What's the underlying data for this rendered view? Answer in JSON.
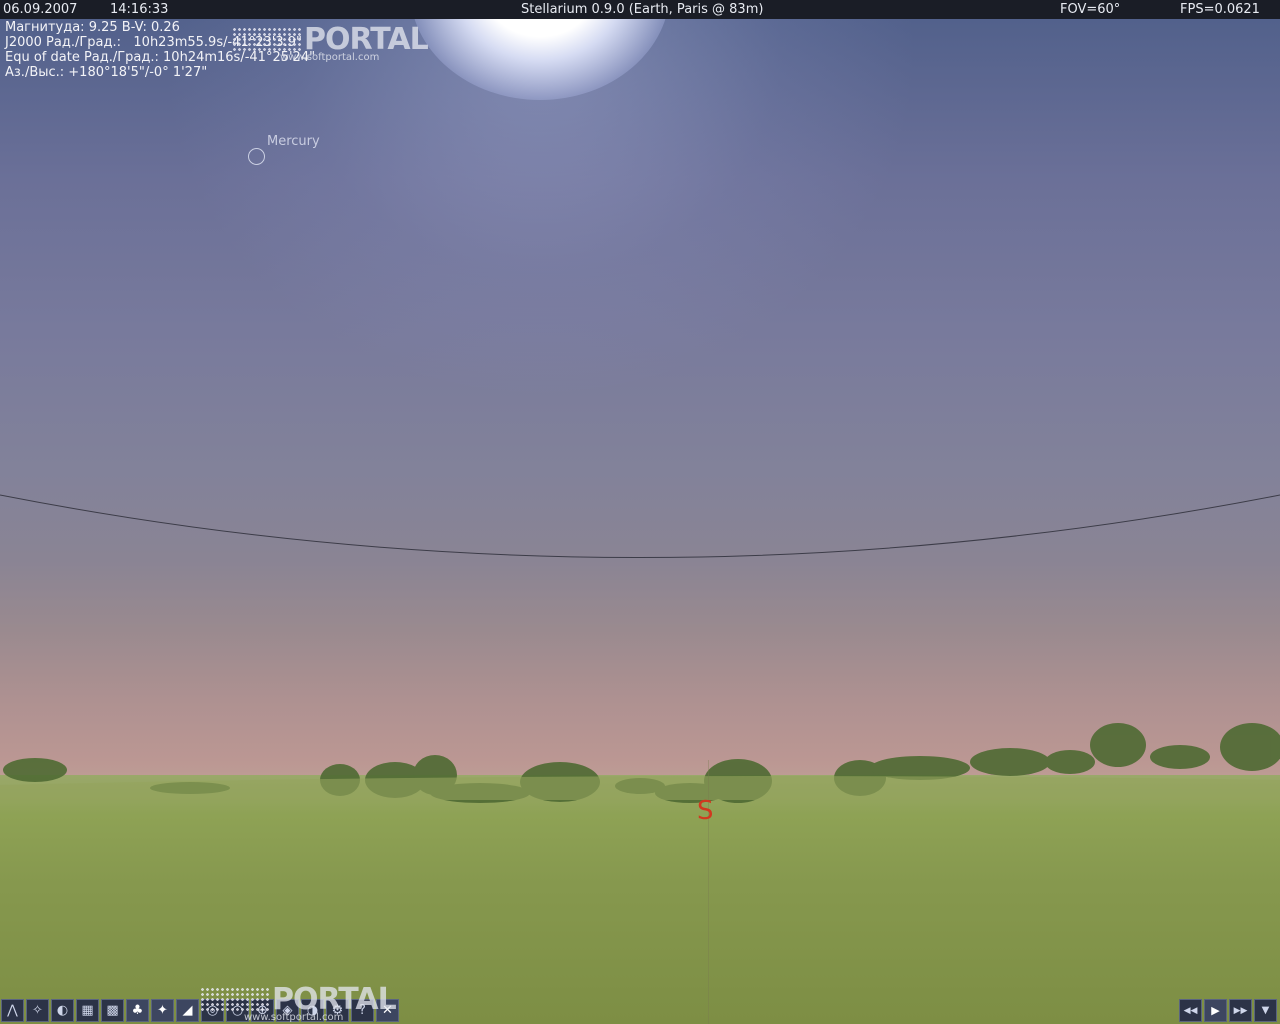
{
  "topbar": {
    "date": "06.09.2007",
    "time": "14:16:33",
    "title": "Stellarium 0.9.0 (Earth, Paris @ 83m)",
    "fov": "FOV=60°",
    "fps": "FPS=0.0621"
  },
  "info": {
    "line1": "Магнитуда: 9.25 B-V: 0.26",
    "line2": "J2000 Рад./Град.:   10h23m55.9s/-41°23'3.9\"",
    "line3": "Equ of date Рад./Град.: 10h24m16s/-41°25'24\"",
    "line4": "Аз./Выс.: +180°18'5\"/-0° 1'27\""
  },
  "sky": {
    "selected_object": "Mercury",
    "cardinal_point": "S",
    "cardinal_color": "#d2381f"
  },
  "watermark": {
    "brand": "PORTAL",
    "url": "www.softportal.com"
  },
  "toolbar_left": [
    {
      "icon": "constellation-lines-icon",
      "glyph": "⋀",
      "active": false
    },
    {
      "icon": "constellation-names-icon",
      "glyph": "✧",
      "active": false
    },
    {
      "icon": "constellation-art-icon",
      "glyph": "◐",
      "active": false
    },
    {
      "icon": "equatorial-grid-icon",
      "glyph": "▦",
      "active": false
    },
    {
      "icon": "azimuthal-grid-icon",
      "glyph": "▩",
      "active": false
    },
    {
      "icon": "ground-icon",
      "glyph": "♣",
      "active": true
    },
    {
      "icon": "cardinal-points-icon",
      "glyph": "✦",
      "active": true
    },
    {
      "icon": "atmosphere-icon",
      "glyph": "◢",
      "active": true
    },
    {
      "icon": "nebulae-icon",
      "glyph": "◎",
      "active": false
    },
    {
      "icon": "planets-labels-icon",
      "glyph": "○",
      "active": false
    },
    {
      "icon": "equatorial-mount-icon",
      "glyph": "⊕",
      "active": false
    },
    {
      "icon": "goto-icon",
      "glyph": "◈",
      "active": false
    },
    {
      "icon": "night-mode-icon",
      "glyph": "◑",
      "active": false
    },
    {
      "icon": "config-icon",
      "glyph": "⚙",
      "active": false
    },
    {
      "icon": "help-icon",
      "glyph": "?",
      "active": false
    },
    {
      "icon": "quit-icon",
      "glyph": "✕",
      "active": true
    }
  ],
  "toolbar_right": [
    {
      "icon": "rewind-icon",
      "glyph": "◀◀"
    },
    {
      "icon": "play-icon",
      "glyph": "▶"
    },
    {
      "icon": "fast-forward-icon",
      "glyph": "▶▶"
    },
    {
      "icon": "time-menu-icon",
      "glyph": "▼"
    }
  ]
}
